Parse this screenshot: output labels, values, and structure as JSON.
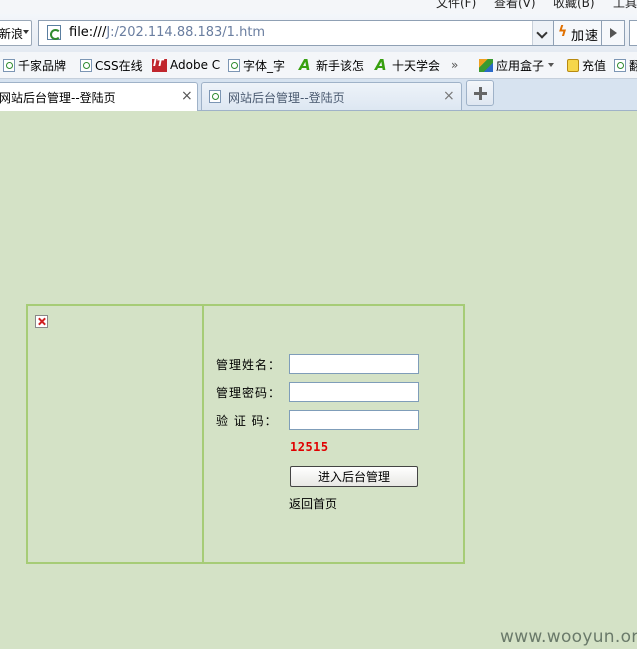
{
  "menubar": {
    "items": [
      "文件(F)",
      "查看(V)",
      "收藏(B)",
      "工具"
    ]
  },
  "address_bar": {
    "engine_label": "新浪",
    "url_prefix": "file:///",
    "url_rest": "J:/202.114.88.183/1.htm",
    "speed_label": "加速"
  },
  "favorites": [
    {
      "label": "千家品牌",
      "icon": "page-icon"
    },
    {
      "label": "CSS在线",
      "icon": "page-icon"
    },
    {
      "label": "Adobe C",
      "icon": "adobe-icon"
    },
    {
      "label": "字体_字",
      "icon": "page-icon"
    },
    {
      "label": "新手该怎",
      "icon": "green-a-icon"
    },
    {
      "label": "十天学会",
      "icon": "green-a-icon"
    },
    {
      "label": "»",
      "icon": "chevron-icon"
    },
    {
      "label": "应用盒子",
      "icon": "app-box-icon"
    },
    {
      "label": "充值",
      "icon": "coin-icon"
    },
    {
      "label": "翻",
      "icon": "page-icon"
    }
  ],
  "tabs": [
    {
      "title": "网站后台管理--登陆页",
      "active": true,
      "close": "×"
    },
    {
      "title": "网站后台管理--登陆页",
      "active": false,
      "close": "×"
    }
  ],
  "login": {
    "username_label": "管理姓名：",
    "password_label": "管理密码：",
    "captcha_label": "验 证 码：",
    "username_value": "",
    "password_value": "",
    "captcha_value": "",
    "captcha_code": "12515",
    "submit_label": "进入后台管理",
    "back_link": "返回首页"
  },
  "watermark": "www.wooyun.org"
}
